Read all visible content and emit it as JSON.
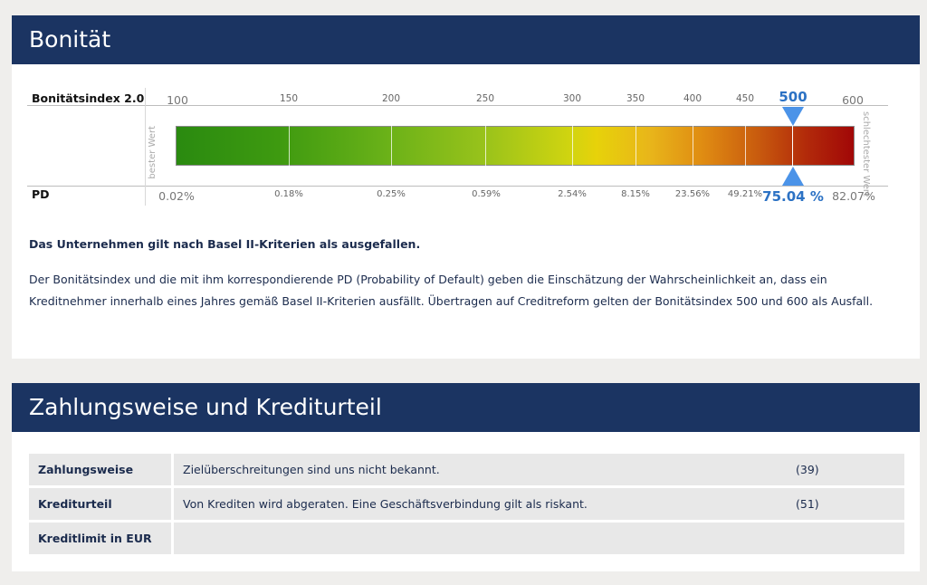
{
  "bonitaet": {
    "title": "Bonität",
    "index_label": "Bonitätsindex 2.0",
    "pd_label": "PD",
    "best_label": "bester Wert",
    "worst_label": "schlechtester Wert",
    "scale_ticks": [
      "100",
      "150",
      "200",
      "250",
      "300",
      "350",
      "400",
      "450",
      "500",
      "600"
    ],
    "pd_ticks": [
      "0.02%",
      "0.18%",
      "0.25%",
      "0.59%",
      "2.54%",
      "8.15%",
      "23.56%",
      "49.21%",
      "75.04 %",
      "82.07%"
    ],
    "current_index": "500",
    "current_pd": "75.04 %",
    "verdict": "Das Unternehmen gilt nach Basel II-Kriterien als ausgefallen.",
    "description": "Der Bonitätsindex und die mit ihm korrespondierende PD (Probability of Default) geben die Einschätzung der Wahrscheinlichkeit an, dass ein Kreditnehmer innerhalb eines Jahres gemäß Basel II-Kriterien ausfällt. Übertragen auf Creditreform gelten der Bonitätsindex 500 und 600 als Ausfall.",
    "colors": {
      "marker": "#4b93e8",
      "active_text": "#2c72c4",
      "header_bg": "#1b3462"
    }
  },
  "zahlung": {
    "title": "Zahlungsweise und Krediturteil",
    "rows": [
      {
        "key": "Zahlungsweise",
        "value": "Zielüberschreitungen sind uns nicht bekannt.",
        "score": "(39)"
      },
      {
        "key": "Krediturteil",
        "value": "Von Krediten wird abgeraten. Eine Geschäftsverbindung gilt als riskant.",
        "score": "(51)"
      },
      {
        "key": "Kreditlimit in EUR",
        "value": "",
        "score": ""
      }
    ]
  }
}
